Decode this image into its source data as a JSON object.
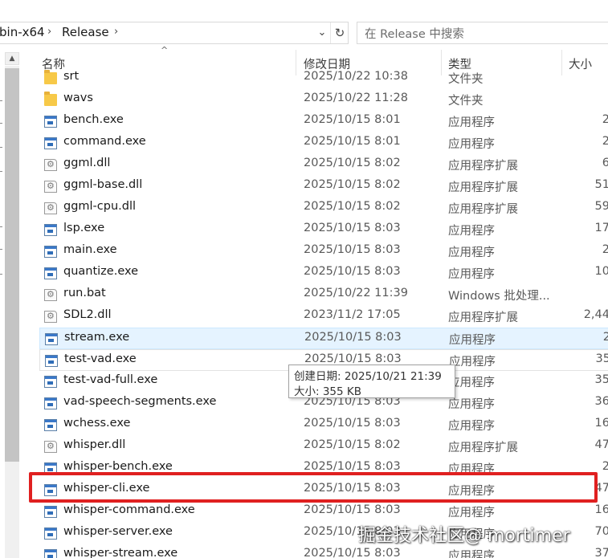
{
  "address": {
    "crumbs": [
      "bin-x64",
      "Release"
    ],
    "refresh_icon": "refresh-icon",
    "dropdown_icon": "chevron-down-icon"
  },
  "search": {
    "placeholder": "在 Release 中搜索"
  },
  "columns": {
    "name": "名称",
    "date": "修改日期",
    "type": "类型",
    "size": "大小"
  },
  "files": [
    {
      "name": "srt",
      "date": "2025/10/22 10:38",
      "type": "文件夹",
      "size": "",
      "icon": "folder"
    },
    {
      "name": "wavs",
      "date": "2025/10/22 11:28",
      "type": "文件夹",
      "size": "",
      "icon": "folder"
    },
    {
      "name": "bench.exe",
      "date": "2025/10/15 8:01",
      "type": "应用程序",
      "size": "2",
      "icon": "exe"
    },
    {
      "name": "command.exe",
      "date": "2025/10/15 8:01",
      "type": "应用程序",
      "size": "2",
      "icon": "exe"
    },
    {
      "name": "ggml.dll",
      "date": "2025/10/15 8:02",
      "type": "应用程序扩展",
      "size": "6",
      "icon": "dll"
    },
    {
      "name": "ggml-base.dll",
      "date": "2025/10/15 8:02",
      "type": "应用程序扩展",
      "size": "51",
      "icon": "dll"
    },
    {
      "name": "ggml-cpu.dll",
      "date": "2025/10/15 8:02",
      "type": "应用程序扩展",
      "size": "59",
      "icon": "dll"
    },
    {
      "name": "lsp.exe",
      "date": "2025/10/15 8:03",
      "type": "应用程序",
      "size": "17",
      "icon": "exe"
    },
    {
      "name": "main.exe",
      "date": "2025/10/15 8:03",
      "type": "应用程序",
      "size": "2",
      "icon": "exe"
    },
    {
      "name": "quantize.exe",
      "date": "2025/10/15 8:03",
      "type": "应用程序",
      "size": "10",
      "icon": "exe"
    },
    {
      "name": "run.bat",
      "date": "2025/10/22 11:39",
      "type": "Windows 批处理...",
      "size": "",
      "icon": "dll"
    },
    {
      "name": "SDL2.dll",
      "date": "2023/11/2 17:05",
      "type": "应用程序扩展",
      "size": "2,44",
      "icon": "dll"
    },
    {
      "name": "stream.exe",
      "date": "2025/10/15 8:03",
      "type": "应用程序",
      "size": "2",
      "icon": "exe",
      "selected": true
    },
    {
      "name": "test-vad.exe",
      "date": "2025/10/15 8:03",
      "type": "应用程序",
      "size": "35",
      "icon": "exe",
      "hover": true
    },
    {
      "name": "test-vad-full.exe",
      "date": "2025/10/15 8:03",
      "type": "应用程序",
      "size": "35",
      "icon": "exe"
    },
    {
      "name": "vad-speech-segments.exe",
      "date": "2025/10/15 8:03",
      "type": "应用程序",
      "size": "36",
      "icon": "exe"
    },
    {
      "name": "wchess.exe",
      "date": "2025/10/15 8:03",
      "type": "应用程序",
      "size": "16",
      "icon": "exe"
    },
    {
      "name": "whisper.dll",
      "date": "2025/10/15 8:02",
      "type": "应用程序扩展",
      "size": "47",
      "icon": "dll"
    },
    {
      "name": "whisper-bench.exe",
      "date": "2025/10/15 8:03",
      "type": "应用程序",
      "size": "2",
      "icon": "exe"
    },
    {
      "name": "whisper-cli.exe",
      "date": "2025/10/15 8:03",
      "type": "应用程序",
      "size": "47",
      "icon": "exe"
    },
    {
      "name": "whisper-command.exe",
      "date": "2025/10/15 8:03",
      "type": "应用程序",
      "size": "16",
      "icon": "exe"
    },
    {
      "name": "whisper-server.exe",
      "date": "2025/10/15 8:03",
      "type": "应用程序",
      "size": "70",
      "icon": "exe"
    },
    {
      "name": "whisper-stream.exe",
      "date": "2025/10/15 8:03",
      "type": "应用程序",
      "size": "37",
      "icon": "exe"
    }
  ],
  "tooltip": {
    "created": "创建日期: 2025/10/21 21:39",
    "size": "大小: 355 KB"
  },
  "watermark": "掘金技术社区@ mortimer",
  "colors": {
    "selection": "#e5f3ff",
    "highlight_box": "#e02020",
    "folder": "#f7c948"
  }
}
